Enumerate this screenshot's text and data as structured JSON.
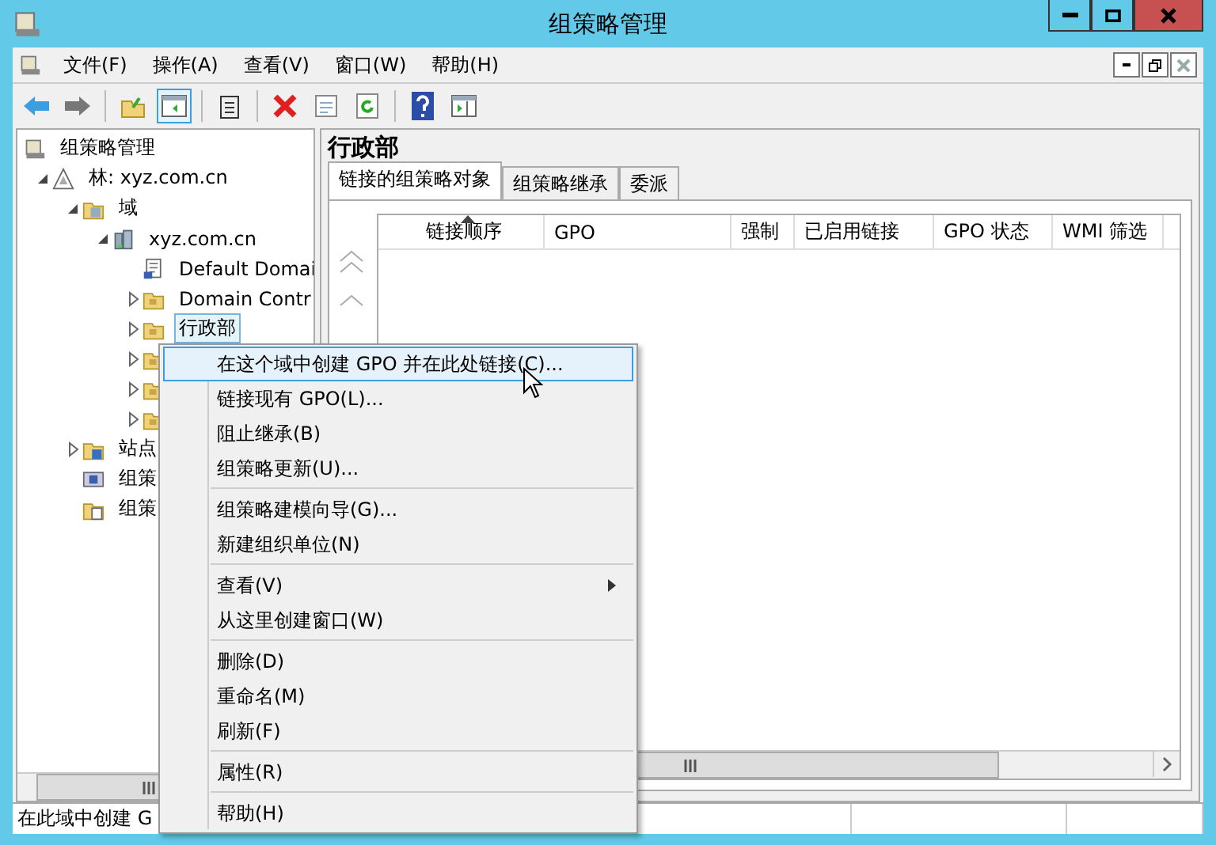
{
  "window": {
    "title": "组策略管理"
  },
  "menu_bar": [
    "文件(F)",
    "操作(A)",
    "查看(V)",
    "窗口(W)",
    "帮助(H)"
  ],
  "tree": [
    {
      "label": "组策略管理",
      "kind": "console",
      "children": [
        {
          "label": "林: xyz.com.cn",
          "kind": "forest",
          "expanded": true,
          "children": [
            {
              "label": "域",
              "kind": "domains",
              "expanded": true,
              "children": [
                {
                  "label": "xyz.com.cn",
                  "kind": "domain",
                  "expanded": true,
                  "children": [
                    {
                      "label": "Default Domai",
                      "kind": "gpo",
                      "selected": false
                    },
                    {
                      "label": "Domain Contr",
                      "kind": "ou",
                      "expanded": false,
                      "selected": false
                    },
                    {
                      "label": "行政部",
                      "kind": "ou",
                      "expanded": false,
                      "selected": true
                    },
                    {
                      "kind": "ou",
                      "expanded": false,
                      "selected": false
                    },
                    {
                      "kind": "ou",
                      "expanded": false,
                      "selected": false
                    },
                    {
                      "kind": "ou",
                      "expanded": false,
                      "selected": false
                    }
                  ]
                }
              ]
            },
            {
              "label": "站点",
              "kind": "sites",
              "expanded": false
            },
            {
              "label": "组策",
              "kind": "modeling"
            },
            {
              "label": "组策",
              "kind": "results"
            }
          ]
        }
      ]
    }
  ],
  "detail": {
    "title": "行政部",
    "tabs": [
      {
        "label": "链接的组策略对象",
        "selected": true
      },
      {
        "label": "组策略继承",
        "selected": false
      },
      {
        "label": "委派",
        "selected": false
      }
    ],
    "columns": [
      {
        "label": "链接顺序",
        "sorted": true
      },
      {
        "label": "GPO",
        "sorted": false
      },
      {
        "label": "强制",
        "sorted": false
      },
      {
        "label": "已启用链接",
        "sorted": false
      },
      {
        "label": "GPO 状态",
        "sorted": false
      },
      {
        "label": "WMI 筛选",
        "sorted": false
      }
    ]
  },
  "context_menu": [
    [
      {
        "label": "在这个域中创建 GPO 并在此处链接(C)...",
        "selected": true
      },
      {
        "label": "链接现有 GPO(L)...",
        "selected": false
      },
      {
        "label": "阻止继承(B)",
        "selected": false
      },
      {
        "label": "组策略更新(U)...",
        "selected": false
      }
    ],
    [
      {
        "label": "组策略建模向导(G)...",
        "selected": false
      },
      {
        "label": "新建组织单位(N)",
        "selected": false
      }
    ],
    [
      {
        "label": "查看(V)",
        "selected": false,
        "submenu": true
      },
      {
        "label": "从这里创建窗口(W)",
        "selected": false
      }
    ],
    [
      {
        "label": "删除(D)",
        "selected": false
      },
      {
        "label": "重命名(M)",
        "selected": false
      },
      {
        "label": "刷新(F)",
        "selected": false
      }
    ],
    [
      {
        "label": "属性(R)",
        "selected": false
      }
    ],
    [
      {
        "label": "帮助(H)",
        "selected": false
      }
    ]
  ],
  "status_bar": "在此域中创建 G"
}
